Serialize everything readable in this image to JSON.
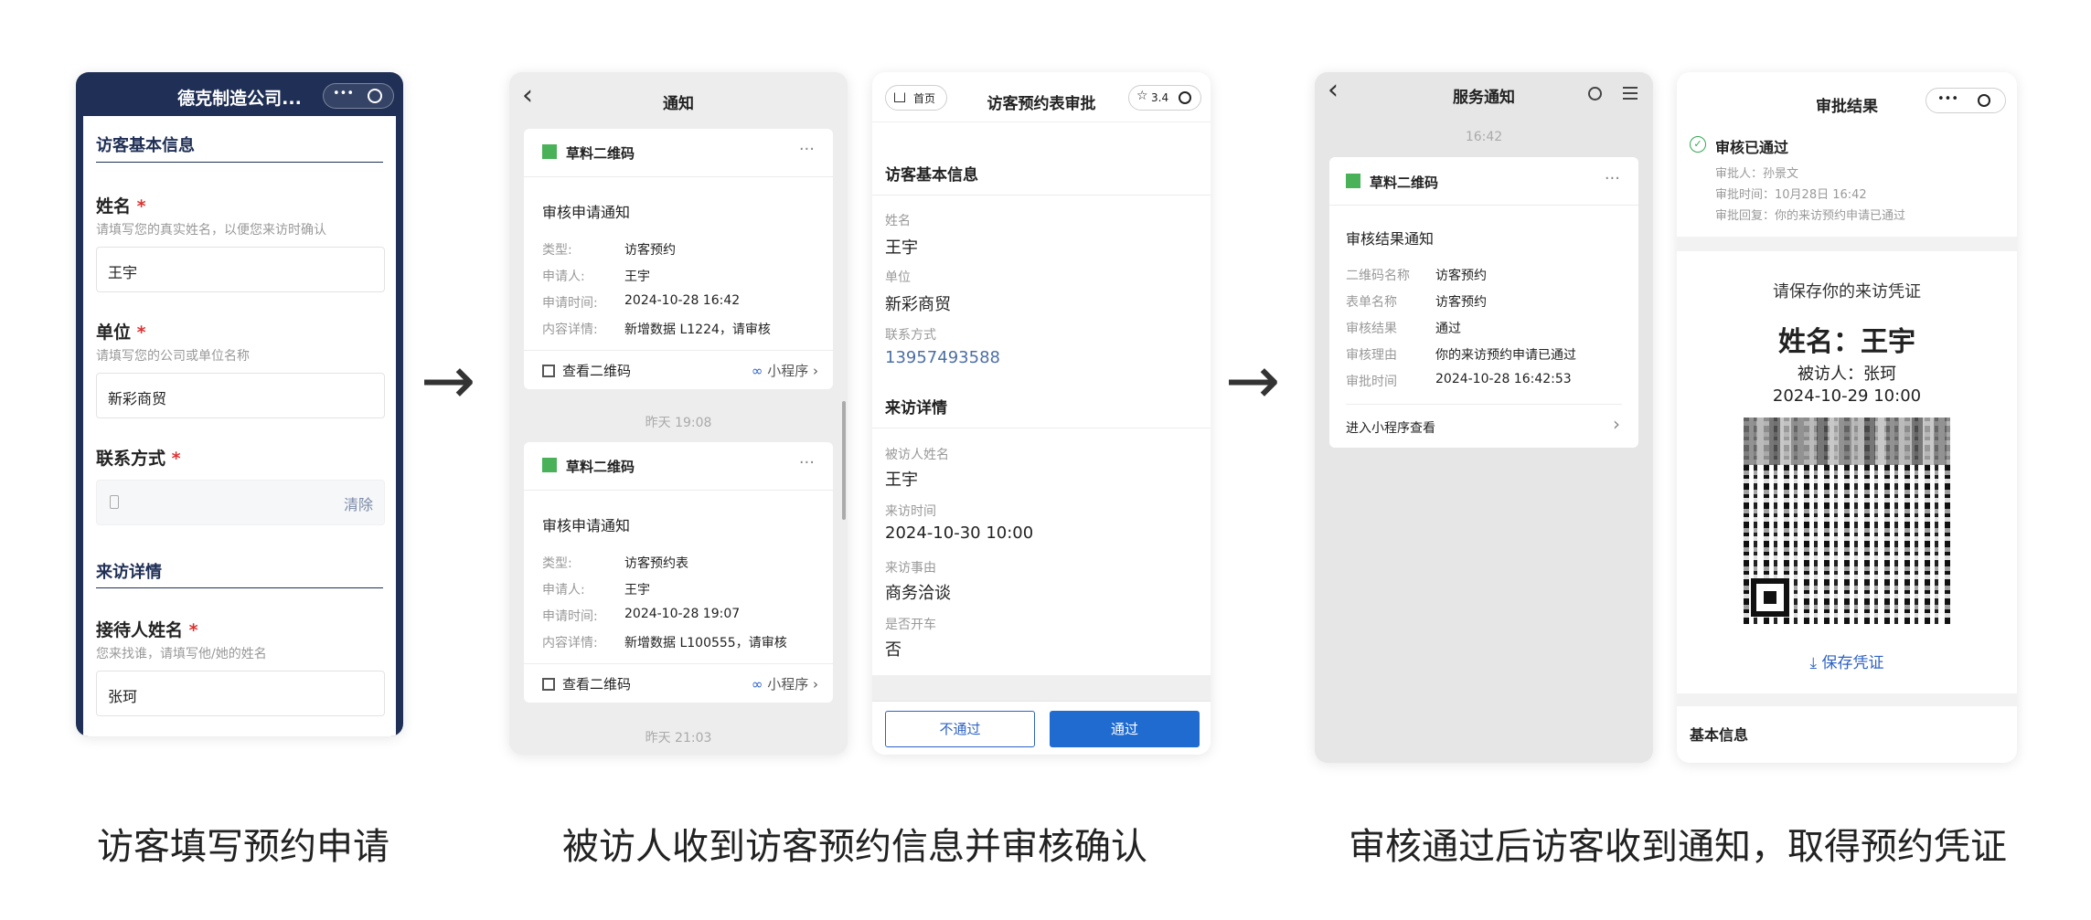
{
  "colors": {
    "brand_dark": "#1f2f55",
    "link_blue": "#2e62c4",
    "approve_blue": "#1f6bd0",
    "success_green": "#34a853",
    "qr_green": "#49b158"
  },
  "arrows": [
    "→",
    "→"
  ],
  "captions": [
    "访客填写预约申请",
    "被访人收到访客预约信息并审核确认",
    "审核通过后访客收到通知，取得预约凭证"
  ],
  "phone1": {
    "title": "德克制造公司...",
    "dots": "•••",
    "section_basic": "访客基本信息",
    "name_label": "姓名",
    "name_hint": "请填写您的真实姓名，以便您来访时确认",
    "name_value": "王宇",
    "unit_label": "单位",
    "unit_hint": "请填写您的公司或单位名称",
    "unit_value": "新彩商贸",
    "contact_label": "联系方式",
    "clear": "清除",
    "section_visit": "来访详情",
    "host_label": "接待人姓名",
    "host_hint": "您来找谁，请填写他/她的姓名",
    "host_value": "张珂",
    "required": "*"
  },
  "phone2": {
    "title": "通知",
    "back": "‹",
    "time2": "昨天 19:08",
    "time3": "昨天 21:03",
    "card_app": "草料二维码",
    "more": "···",
    "view_qr": "查看二维码",
    "mini": "小程序",
    "cards": [
      {
        "title": "审核申请通知",
        "rows": [
          [
            "类型:",
            "访客预约"
          ],
          [
            "申请人:",
            "王宇"
          ],
          [
            "申请时间:",
            "2024-10-28 16:42"
          ],
          [
            "内容详情:",
            "新增数据 L1224，请审核"
          ]
        ]
      },
      {
        "title": "审核申请通知",
        "rows": [
          [
            "类型:",
            "访客预约表"
          ],
          [
            "申请人:",
            "王宇"
          ],
          [
            "申请时间:",
            "2024-10-28 19:07"
          ],
          [
            "内容详情:",
            "新增数据 L100555，请审核"
          ]
        ]
      }
    ]
  },
  "phone3": {
    "home": "首页",
    "title": "访客预约表审批",
    "rating": "3.4",
    "section_basic": "访客基本信息",
    "fields_basic": [
      [
        "姓名",
        "王宇"
      ],
      [
        "单位",
        "新彩商贸"
      ],
      [
        "联系方式",
        "13957493588"
      ]
    ],
    "section_visit": "来访详情",
    "fields_visit": [
      [
        "被访人姓名",
        "王宇"
      ],
      [
        "来访时间",
        "2024-10-30 10:00"
      ],
      [
        "来访事由",
        "商务洽谈"
      ],
      [
        "是否开车",
        "否"
      ]
    ],
    "reject": "不通过",
    "approve": "通过"
  },
  "phone4": {
    "title": "服务通知",
    "back": "‹",
    "time": "16:42",
    "card_app": "草料二维码",
    "more": "···",
    "card_title": "审核结果通知",
    "rows": [
      [
        "二维码名称",
        "访客预约"
      ],
      [
        "表单名称",
        "访客预约"
      ],
      [
        "审核结果",
        "通过"
      ],
      [
        "审核理由",
        "你的来访预约申请已通过"
      ],
      [
        "审批时间",
        "2024-10-28 16:42:53"
      ]
    ],
    "enter": "进入小程序查看",
    "chevron": "›"
  },
  "phone5": {
    "title": "审批结果",
    "dots": "•••",
    "status": "审核已通过",
    "approver": "审批人：孙景文",
    "approve_time": "审批时间：10月28日 16:42",
    "reply": "审批回复：你的来访预约申请已通过",
    "save_hint": "请保存你的来访凭证",
    "big_name": "姓名：王宇",
    "visitee": "被访人：张珂",
    "datetime": "2024-10-29 10:00",
    "save_btn": "保存凭证",
    "basic": "基本信息"
  }
}
